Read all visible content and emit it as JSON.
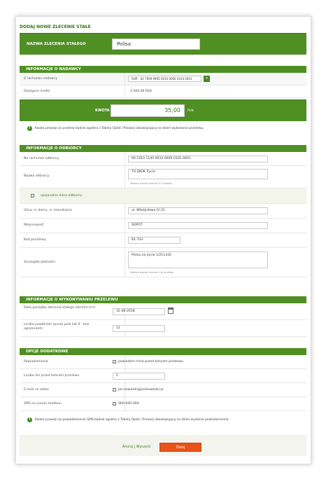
{
  "page_title": "DODAJ NOWE ZLECENIE STAŁE",
  "order_name": {
    "label": "NAZWA ZLECENIA STAŁEGO",
    "value": "Polisa"
  },
  "sender": {
    "header": "INFORMACJE O NADAWCY",
    "account_label": "Z rachunku nadawcy",
    "account_value": "ROR - 62 7999 9995 0010 0000 0104 0001",
    "funds_label": "Dostępne środki",
    "funds_value": "3 500,00 PLN",
    "amount_label": "KWOTA",
    "amount_value": "35,00",
    "currency": "PLN",
    "info": "Kwota prowizji za przelew będzie zgodna z Tabelą Opłat i Prowizji obowiązującą na dzień wykonania przelewu."
  },
  "recipient": {
    "header": "INFORMACJE O ODBIORCY",
    "account_label": "Na rachunek odbiorcy",
    "account_value": "00 1010 1140 0010 0000 0101 0001",
    "name_label": "Nazwa odbiorcy",
    "name_value": "TU SKOK Życie",
    "name_hint": "Możesz wpisać jeszcze 57 znaków.",
    "optional_label": "opcjonalne dane odbiorcy",
    "street_label": "Ulica, nr domu, nr mieszkania",
    "street_value": "ul. Władysława IV 22",
    "city_label": "Miejscowość",
    "city_value": "SOPOT",
    "zip_label": "Kod pocztowy",
    "zip_value": "81-743",
    "details_label": "Szczegóły płatności",
    "details_value": "Polisa na życie 1/211342",
    "details_hint": "Możesz wpisać jeszcze 116 znaków."
  },
  "execution": {
    "header": "INFORMACJE O WYKONYWANIU PRZELEWU",
    "start_label": "Data początku zlecenia stałego (dd-mm-rrrr)",
    "start_value": "31-08-2018",
    "repeat_label": "Liczba powtórzeń (puste pole lub 0 - bez ograniczeń)",
    "repeat_value": "12"
  },
  "options": {
    "header": "OPCJE DODATKOWE",
    "notify_label": "Powiadomienie",
    "notify_value": "powiadom mnie przed końcem przelewu",
    "days_label": "Liczba dni przed końcem przelewu",
    "days_value": "2",
    "email_label": "E-mail na adres",
    "email_value": "jan.kowalski@jankowalski.pl",
    "sms_label": "SMS na numer telefonu",
    "sms_value": "000-000-000",
    "info": "Kwota prowizji za powiadomienie SMS będzie zgodna z Tabelą Opłat i Prowizji obowiązującą na dzień wysłania powiadomienia."
  },
  "footer": {
    "cancel": "Anuluj | Wyczyść",
    "next": "Dalej"
  }
}
